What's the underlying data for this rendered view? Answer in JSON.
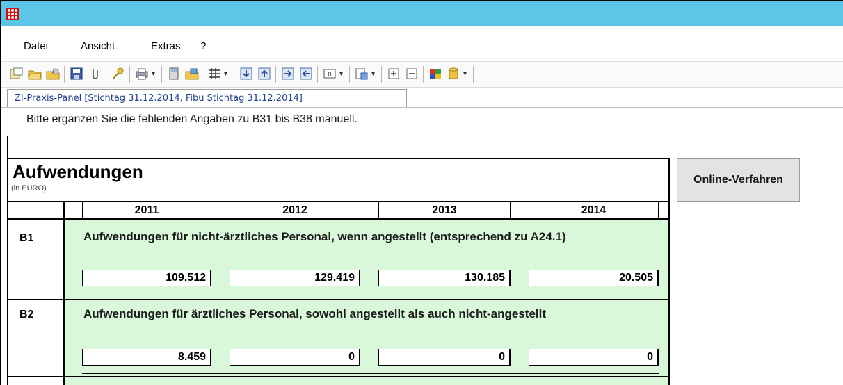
{
  "menu": [
    "Datei",
    "Ansicht",
    "Extras",
    "?"
  ],
  "toolbar": {
    "icons": [
      "new-document-icon",
      "open-folder-icon",
      "open-multiple-icon",
      "save-icon",
      "attachment-icon",
      "key-icon",
      "print-icon",
      "calculator-icon",
      "folder-copy-icon",
      "grid-icon",
      "move-down-icon",
      "move-up-icon",
      "move-right-icon",
      "move-left-icon",
      "zero-field-icon",
      "export-icon",
      "expand-icon",
      "collapse-icon",
      "color-icon",
      "database-icon"
    ]
  },
  "tab": {
    "label": "ZI-Praxis-Panel [Stichtag 31.12.2014, Fibu Stichtag 31.12.2014]"
  },
  "hint": "Bitte ergänzen Sie die fehlenden Angaben zu B31 bis B38 manuell.",
  "section": {
    "title": "Aufwendungen",
    "unit": "(in EURO)"
  },
  "online_button": "Online-Verfahren",
  "years": [
    "2011",
    "2012",
    "2013",
    "2014"
  ],
  "rows": [
    {
      "code": "B1",
      "text": "Aufwendungen für nicht-ärztliches Personal, wenn angestellt (entsprechend zu A24.1)",
      "values": [
        "109.512",
        "129.419",
        "130.185",
        "20.505"
      ]
    },
    {
      "code": "B2",
      "text": "Aufwendungen für ärztliches Personal, sowohl angestellt als auch nicht-angestellt",
      "values": [
        "8.459",
        "0",
        "0",
        "0"
      ]
    }
  ],
  "colors": {
    "titlebar": "#5bc6e8",
    "row_background": "#d9f7d9",
    "tab_text": "#1f3f8f"
  }
}
